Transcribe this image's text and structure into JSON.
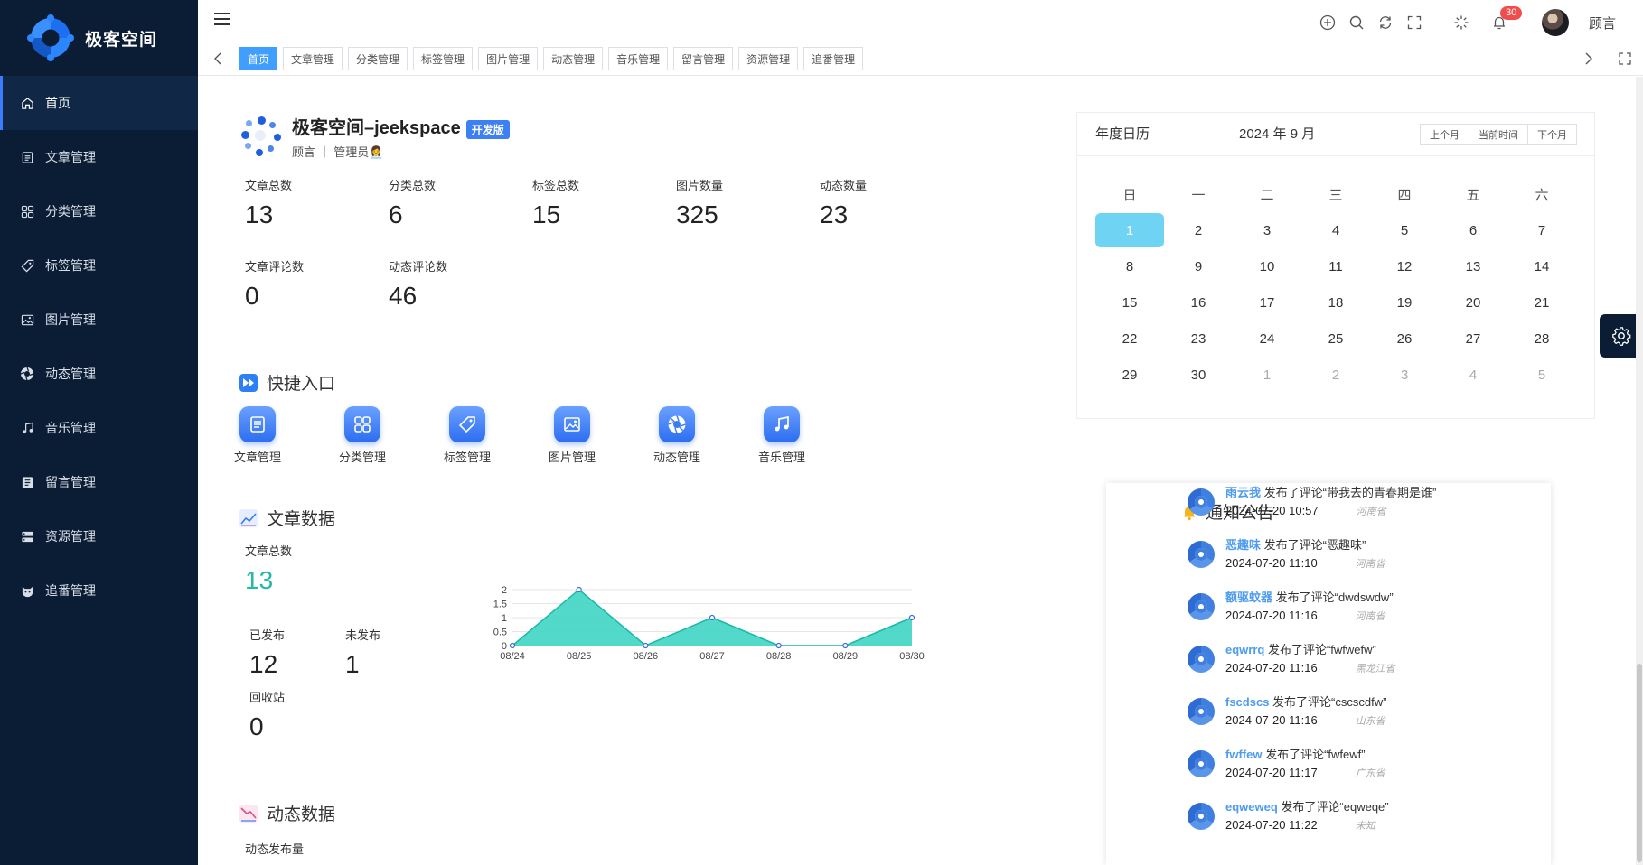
{
  "app": {
    "logo_text": "极客空间"
  },
  "sidebar": {
    "items": [
      {
        "label": "首页",
        "icon": "home-icon"
      },
      {
        "label": "文章管理",
        "icon": "document-icon"
      },
      {
        "label": "分类管理",
        "icon": "grid-icon"
      },
      {
        "label": "标签管理",
        "icon": "tag-icon"
      },
      {
        "label": "图片管理",
        "icon": "image-icon"
      },
      {
        "label": "动态管理",
        "icon": "aperture-icon"
      },
      {
        "label": "音乐管理",
        "icon": "music-icon"
      },
      {
        "label": "留言管理",
        "icon": "message-icon"
      },
      {
        "label": "资源管理",
        "icon": "server-icon"
      },
      {
        "label": "追番管理",
        "icon": "cat-icon"
      }
    ]
  },
  "header": {
    "notification_count": "30",
    "user_name": "顾言",
    "tabs": [
      "首页",
      "文章管理",
      "分类管理",
      "标签管理",
      "图片管理",
      "动态管理",
      "音乐管理",
      "留言管理",
      "资源管理",
      "追番管理"
    ]
  },
  "site": {
    "title": "极客空间–jeekspace",
    "badge": "开发版",
    "subtitle": "顾言 ｜ 管理员👩‍💼"
  },
  "stats": [
    {
      "label": "文章总数",
      "value": "13"
    },
    {
      "label": "分类总数",
      "value": "6"
    },
    {
      "label": "标签总数",
      "value": "15"
    },
    {
      "label": "图片数量",
      "value": "325"
    },
    {
      "label": "动态数量",
      "value": "23"
    },
    {
      "label": "文章评论数",
      "value": "0"
    },
    {
      "label": "动态评论数",
      "value": "46"
    }
  ],
  "quick": {
    "title": "快捷入口",
    "items": [
      "文章管理",
      "分类管理",
      "标签管理",
      "图片管理",
      "动态管理",
      "音乐管理"
    ]
  },
  "article_data": {
    "title": "文章数据",
    "total_label": "文章总数",
    "total_value": "13",
    "published_label": "已发布",
    "published_value": "12",
    "unpublished_label": "未发布",
    "unpublished_value": "1",
    "recycle_label": "回收站",
    "recycle_value": "0"
  },
  "dynamic_data": {
    "title": "动态数据",
    "label": "动态发布量"
  },
  "chart_data": {
    "type": "area",
    "categories": [
      "08/24",
      "08/25",
      "08/26",
      "08/27",
      "08/28",
      "08/29",
      "08/30"
    ],
    "values": [
      0,
      2,
      0,
      1,
      0,
      0,
      1
    ],
    "yticks": [
      "0",
      "0.5",
      "1",
      "1.5",
      "2"
    ],
    "ylim": [
      0,
      2
    ],
    "grid": true,
    "color": "#3fd5c4"
  },
  "calendar": {
    "title": "年度日历",
    "month_label": "2024 年 9 月",
    "btn_prev": "上个月",
    "btn_today": "当前时间",
    "btn_next": "下个月",
    "weekdays": [
      "日",
      "一",
      "二",
      "三",
      "四",
      "五",
      "六"
    ],
    "weeks": [
      [
        "1",
        "2",
        "3",
        "4",
        "5",
        "6",
        "7"
      ],
      [
        "8",
        "9",
        "10",
        "11",
        "12",
        "13",
        "14"
      ],
      [
        "15",
        "16",
        "17",
        "18",
        "19",
        "20",
        "21"
      ],
      [
        "22",
        "23",
        "24",
        "25",
        "26",
        "27",
        "28"
      ],
      [
        "29",
        "30",
        "1",
        "2",
        "3",
        "4",
        "5"
      ]
    ],
    "selected": "1"
  },
  "notice": {
    "title": "通知公告",
    "items": [
      {
        "name": "雨云我",
        "action": "发布了评论“带我去的青春期是谁”",
        "time": "2024-07-20 10:57",
        "location": "河南省"
      },
      {
        "name": "恶趣味",
        "action": "发布了评论“恶趣味”",
        "time": "2024-07-20 11:10",
        "location": "河南省"
      },
      {
        "name": "额驱蚊器",
        "action": "发布了评论“dwdswdw”",
        "time": "2024-07-20 11:16",
        "location": "河南省"
      },
      {
        "name": "eqwrrq",
        "action": "发布了评论“fwfwefw”",
        "time": "2024-07-20 11:16",
        "location": "黑龙江省"
      },
      {
        "name": "fscdscs",
        "action": "发布了评论“cscscdfw”",
        "time": "2024-07-20 11:16",
        "location": "山东省"
      },
      {
        "name": "fwffew",
        "action": "发布了评论“fwfewf”",
        "time": "2024-07-20 11:17",
        "location": "广东省"
      },
      {
        "name": "eqweweq",
        "action": "发布了评论“eqweqe”",
        "time": "2024-07-20 11:22",
        "location": "未知"
      }
    ]
  }
}
